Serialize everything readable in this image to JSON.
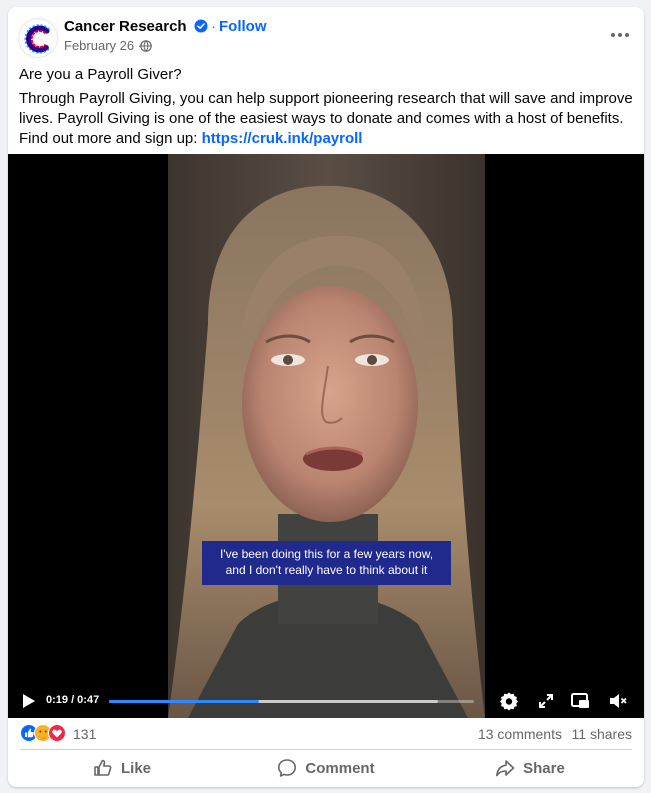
{
  "post": {
    "page_name": "Cancer Research",
    "follow_label": "Follow",
    "follow_separator": "·",
    "date": "February 26 ·",
    "title_line": "Are you a Payroll Giver?",
    "body_text": "Through Payroll Giving, you can help support pioneering research that will save and improve lives. Payroll Giving is one of the easiest ways to donate and comes with a host of benefits. Find out more and sign up: ",
    "link_text": "https://cruk.ink/payroll"
  },
  "video": {
    "subtitle_line1": "I've been doing this for a few years now,",
    "subtitle_line2": "and I don't really have to think about it",
    "timecode": "0:19 / 0:47",
    "progress_fraction": 0.41,
    "buffered_fraction": 0.9
  },
  "engagement": {
    "reaction_count": "131",
    "comments": "13 comments",
    "shares": "11 shares"
  },
  "actions": {
    "like_label": "Like",
    "comment_label": "Comment",
    "share_label": "Share"
  },
  "colors": {
    "accent": "#0866ff",
    "subtitle_bg": "#1f2a8c",
    "progress": "#2d88ff"
  }
}
